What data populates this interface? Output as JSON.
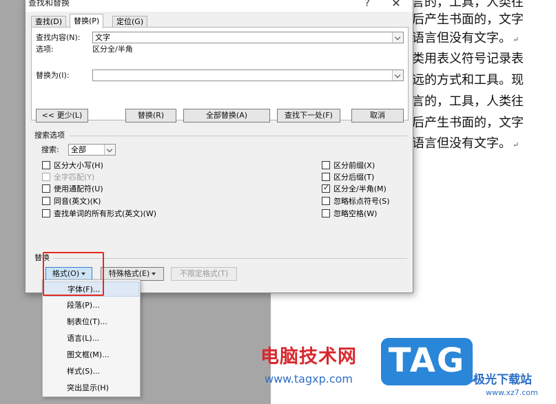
{
  "document": {
    "lines": [
      "言的，工具，人类往",
      "后产生书面的，文字",
      "语言但没有文字。",
      "类用表义符号记录表",
      "远的方式和工具。现",
      "言的，工具，人类往",
      "后产生书面的，文字",
      "语言但没有文字。"
    ]
  },
  "dialog": {
    "title": "查找和替换",
    "help_glyph": "?",
    "close_glyph": "✕",
    "tabs": [
      {
        "label": "查找(D)",
        "active": false
      },
      {
        "label": "替换(P)",
        "active": true
      },
      {
        "label": "定位(G)",
        "active": false
      }
    ],
    "find_label": "查找内容(N):",
    "find_value": "文字",
    "options_label": "选项:",
    "options_value": "区分全/半角",
    "replace_label": "替换为(I):",
    "replace_value": "",
    "buttons": {
      "less": "<< 更少(L)",
      "replace": "替换(R)",
      "replace_all": "全部替换(A)",
      "find_next": "查找下一处(F)",
      "cancel": "取消"
    },
    "search_options_title": "搜索选项",
    "search_label": "搜索:",
    "search_value": "全部",
    "checkboxes_left": [
      {
        "label": "区分大小写(H)",
        "checked": false,
        "disabled": false
      },
      {
        "label": "全字匹配(Y)",
        "checked": false,
        "disabled": true
      },
      {
        "label": "使用通配符(U)",
        "checked": false,
        "disabled": false
      },
      {
        "label": "同音(英文)(K)",
        "checked": false,
        "disabled": false
      },
      {
        "label": "查找单词的所有形式(英文)(W)",
        "checked": false,
        "disabled": false
      }
    ],
    "checkboxes_right": [
      {
        "label": "区分前缀(X)",
        "checked": false,
        "disabled": false
      },
      {
        "label": "区分后缀(T)",
        "checked": false,
        "disabled": false
      },
      {
        "label": "区分全/半角(M)",
        "checked": true,
        "disabled": false
      },
      {
        "label": "忽略标点符号(S)",
        "checked": false,
        "disabled": false
      },
      {
        "label": "忽略空格(W)",
        "checked": false,
        "disabled": false
      }
    ],
    "replace_section_title": "替换",
    "format_button": "格式(O)",
    "special_button": "特殊格式(E)",
    "no_format_button": "不限定格式(T)"
  },
  "format_menu": [
    {
      "label": "字体(F)...",
      "hover": true
    },
    {
      "label": "段落(P)...",
      "hover": false
    },
    {
      "label": "制表位(T)...",
      "hover": false
    },
    {
      "label": "语言(L)...",
      "hover": false
    },
    {
      "label": "图文框(M)...",
      "hover": false
    },
    {
      "label": "样式(S)...",
      "hover": false
    },
    {
      "label": "突出显示(H)",
      "hover": false
    }
  ],
  "watermark": {
    "site_name": "电脑技术网",
    "site_url": "www.tagxp.com",
    "logo_text": "TAG",
    "brand2": "极光下载站",
    "brand2_url": "www.xz7.com"
  },
  "colors": {
    "highlight": "#e5281e",
    "watermark_red": "#d8282e",
    "watermark_blue": "#2a86d8"
  }
}
